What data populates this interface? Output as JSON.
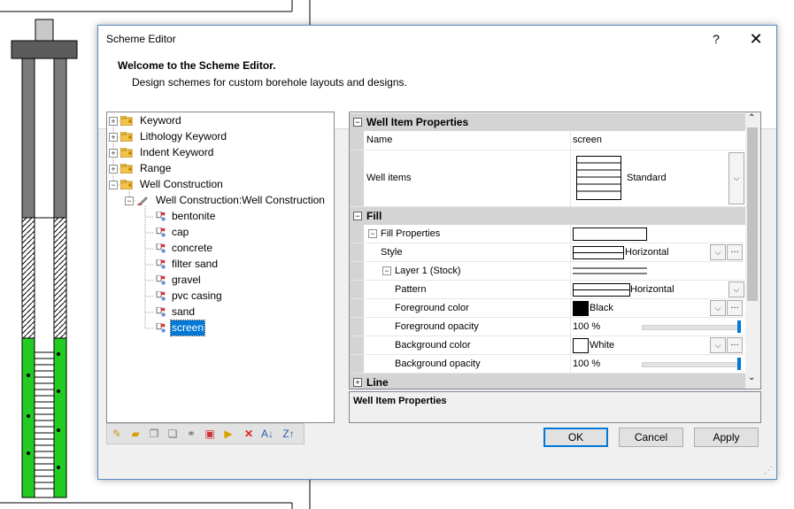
{
  "dialog": {
    "title": "Scheme Editor",
    "help_glyph": "?",
    "close_glyph": "✕",
    "welcome": "Welcome to the Scheme Editor.",
    "description": "Design schemes for custom borehole layouts and designs."
  },
  "tree": {
    "roots": [
      "Keyword",
      "Lithology Keyword",
      "Indent Keyword",
      "Range",
      "Well Construction"
    ],
    "child": "Well Construction:Well Construction",
    "items": [
      "bentonite",
      "cap",
      "concrete",
      "filter sand",
      "gravel",
      "pvc casing",
      "sand",
      "screen"
    ],
    "selected": "screen"
  },
  "toolbar": {
    "icons": [
      "new-scheme-icon",
      "open-icon",
      "copy-icon",
      "duplicate-icon",
      "link-icon",
      "paste-icon",
      "add-item-icon",
      "delete-icon",
      "sort-ascending-icon",
      "sort-descending-icon"
    ]
  },
  "grid": {
    "categories": {
      "well_item": "Well Item Properties",
      "fill": "Fill",
      "line": "Line"
    },
    "name_label": "Name",
    "name_value": "screen",
    "well_items_label": "Well items",
    "well_items_value": "Standard",
    "fill_properties": "Fill Properties",
    "style_label": "Style",
    "style_value": "Horizontal",
    "layer": "Layer 1 (Stock)",
    "pattern_label": "Pattern",
    "pattern_value": "Horizontal",
    "fg_color_label": "Foreground color",
    "fg_color_value": "Black",
    "fg_opacity_label": "Foreground opacity",
    "fg_opacity_value": "100 %",
    "bg_color_label": "Background color",
    "bg_color_value": "White",
    "bg_opacity_label": "Background opacity",
    "bg_opacity_value": "100 %",
    "fg_opacity": 1.0,
    "bg_opacity": 1.0
  },
  "description_panel": {
    "title": "Well Item Properties"
  },
  "buttons": {
    "ok": "OK",
    "cancel": "Cancel",
    "apply": "Apply"
  },
  "colors": {
    "accent": "#0078d7",
    "screen_green": "#22cc22",
    "category_bg": "#d4d4d4"
  }
}
